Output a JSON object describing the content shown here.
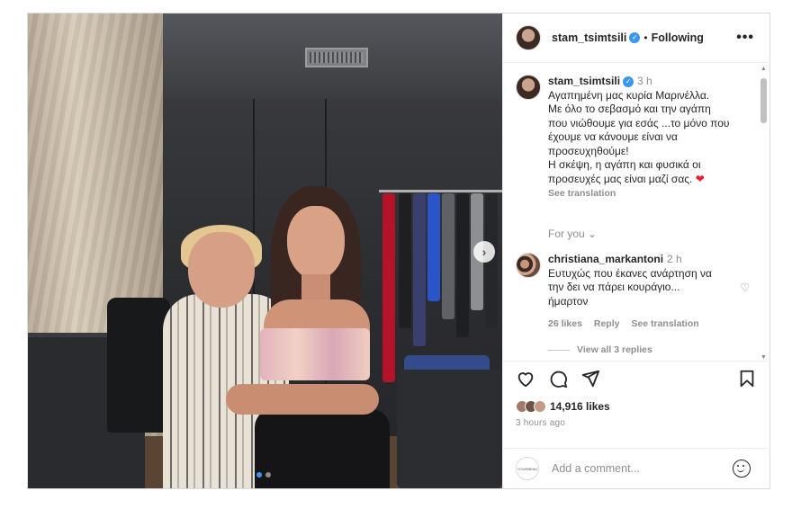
{
  "post": {
    "username": "stam_tsimtsili",
    "follow_label": "Following",
    "more_label": "•••",
    "caption_time": "3 h",
    "caption_lines": [
      "Αγαπημένη μας κυρία Μαρινέλλα.",
      "Με όλο το σεβασμό και την αγάπη",
      "που νιώθουμε για εσάς ...το μόνο που",
      "έχουμε να κάνουμε είναι να",
      "προσευχηθούμε!",
      "Η σκέψη, η αγάπη και φυσικά οι",
      "προσευχές μας είναι μαζί σας."
    ],
    "see_translation": "See translation",
    "for_you": "For you"
  },
  "comment": {
    "username": "christiana_markantoni",
    "time": "2 h",
    "lines": [
      "Ευτυχώς που έκανες ανάρτηση να",
      "την δει να πάρει κουράγιο...",
      "ήμαρτον"
    ],
    "likes": "26 likes",
    "reply": "Reply",
    "see_translation": "See translation",
    "view_replies": "View all 3 replies"
  },
  "engagement": {
    "likes": "14,916 likes",
    "ago": "3 hours ago"
  },
  "add_comment": {
    "placeholder": "Add a comment...",
    "logo_text": "YOURBEAU"
  },
  "icons": {
    "like": "heart-icon",
    "comment": "comment-icon",
    "share": "share-icon",
    "save": "bookmark-icon",
    "next": "chevron-right-icon",
    "emoji": "emoji-icon"
  },
  "colors": {
    "verified": "#3897f0",
    "heart": "#ed1c2e",
    "muted": "#8e8e8e"
  }
}
